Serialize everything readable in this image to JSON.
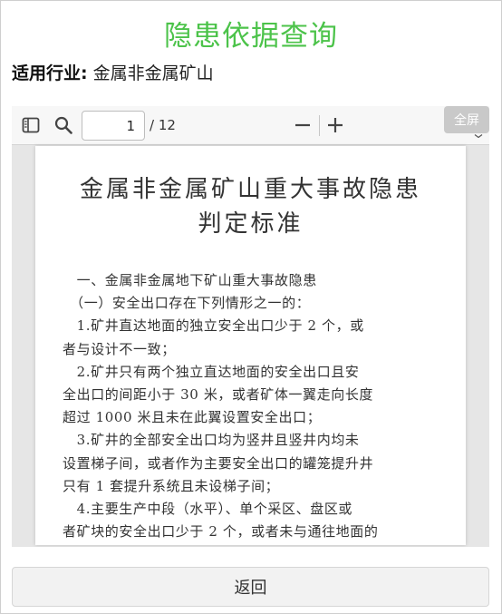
{
  "page": {
    "title": "隐患依据查询",
    "accent_color": "#4cc34a"
  },
  "industry": {
    "label": "适用行业:",
    "value": "金属非金属矿山"
  },
  "viewer": {
    "toolbar": {
      "sidebar_icon": "sidebar-toggle-icon",
      "search_icon": "search-icon",
      "current_page": "1",
      "total_pages": "/ 12",
      "zoom_out_icon": "minus-icon",
      "zoom_in_icon": "plus-icon",
      "fullscreen_label": "全屏"
    },
    "document": {
      "title_line1": "金属非金属矿山重大事故隐患",
      "title_line2": "判定标准",
      "lines": [
        "　一、金属非金属地下矿山重大事故隐患",
        "　（一）安全出口存在下列情形之一的：",
        "　1.矿井直达地面的独立安全出口少于 2 个，或",
        "者与设计不一致；",
        "　2.矿井只有两个独立直达地面的安全出口且安",
        "全出口的间距小于 30 米，或者矿体一翼走向长度",
        "超过 1000 米且未在此翼设置安全出口；",
        "　3.矿井的全部安全出口均为竖井且竖井内均未",
        "设置梯子间，或者作为主要安全出口的罐笼提升井",
        "只有 1 套提升系统且未设梯子间；",
        "　4.主要生产中段（水平）、单个采区、盘区或",
        "者矿块的安全出口少于 2 个，或者未与通往地面的"
      ]
    }
  },
  "footer": {
    "back_label": "返回"
  }
}
